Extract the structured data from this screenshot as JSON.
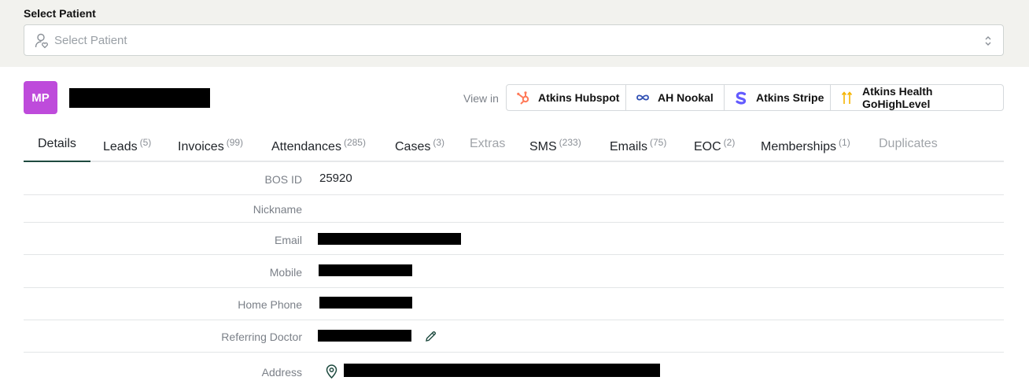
{
  "select_patient": {
    "label": "Select Patient",
    "placeholder": "Select Patient"
  },
  "patient": {
    "initials": "MP",
    "avatar_color": "#be4bdb"
  },
  "view_in": {
    "label": "View in",
    "buttons": [
      {
        "label": "Atkins Hubspot",
        "icon": "hubspot-icon",
        "color": "#ff7a59"
      },
      {
        "label": "AH Nookal",
        "icon": "infinity-icon",
        "color": "#2f4fb3"
      },
      {
        "label": "Atkins Stripe",
        "icon": "stripe-icon",
        "color": "#635bff"
      },
      {
        "label": "Atkins Health GoHighLevel",
        "icon": "gohighlevel-icon",
        "color": "#f5b400"
      }
    ]
  },
  "tabs": [
    {
      "label": "Details",
      "count": ""
    },
    {
      "label": "Leads",
      "count": "(5)"
    },
    {
      "label": "Invoices",
      "count": "(99)"
    },
    {
      "label": "Attendances",
      "count": "(285)"
    },
    {
      "label": "Cases",
      "count": "(3)"
    },
    {
      "label": "Extras",
      "count": ""
    },
    {
      "label": "SMS",
      "count": "(233)"
    },
    {
      "label": "Emails",
      "count": "(75)"
    },
    {
      "label": "EOC",
      "count": "(2)"
    },
    {
      "label": "Memberships",
      "count": "(1)"
    },
    {
      "label": "Duplicates",
      "count": ""
    }
  ],
  "details": {
    "bos_id": {
      "label": "BOS ID",
      "value": "25920"
    },
    "nickname": {
      "label": "Nickname",
      "value": ""
    },
    "email": {
      "label": "Email"
    },
    "mobile": {
      "label": "Mobile"
    },
    "home_phone": {
      "label": "Home Phone"
    },
    "referring_doctor": {
      "label": "Referring Doctor"
    },
    "address": {
      "label": "Address"
    }
  },
  "colors": {
    "accent": "#1e4a3f",
    "top_band": "#f2f2ee"
  }
}
